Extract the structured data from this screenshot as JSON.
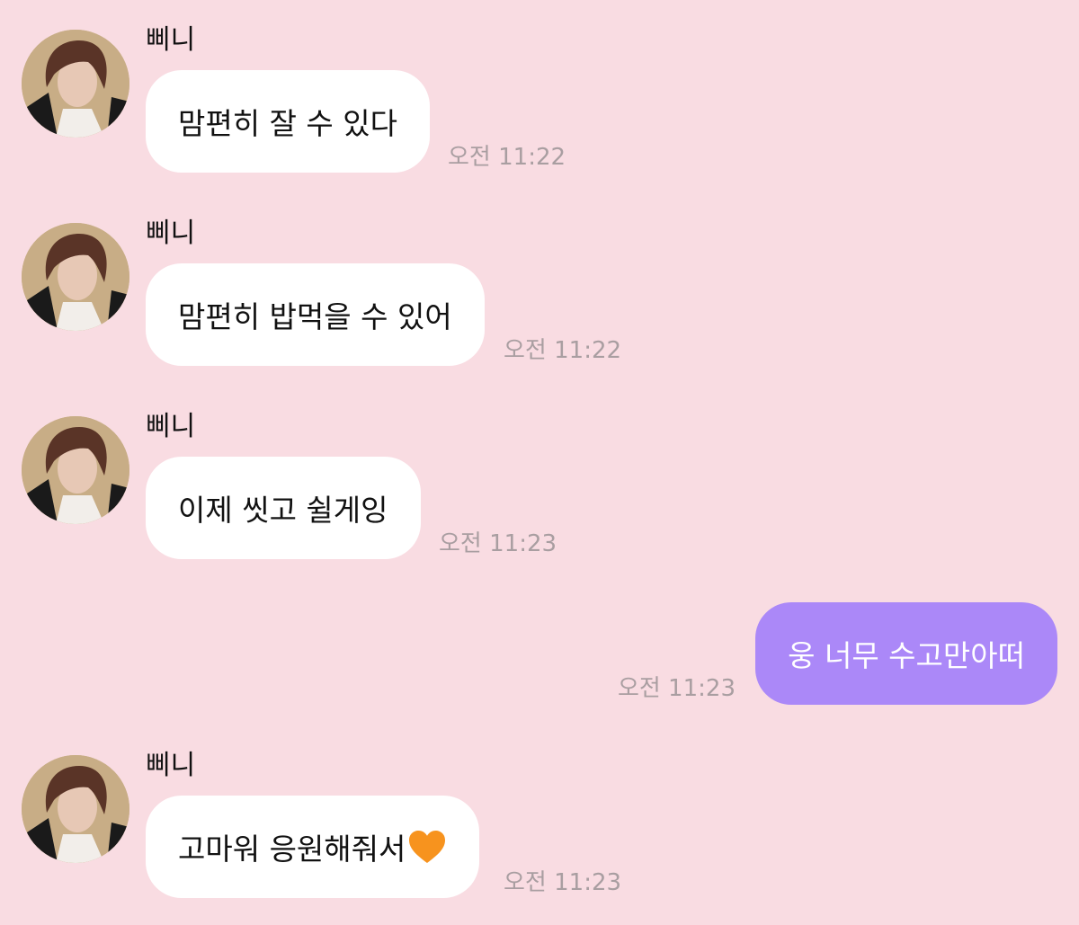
{
  "chat": {
    "messages": [
      {
        "sender": "삐니",
        "text": "맘편히 잘 수 있다",
        "time": "오전 11:22"
      },
      {
        "sender": "삐니",
        "text": "맘편히 밥먹을 수 있어",
        "time": "오전 11:22"
      },
      {
        "sender": "삐니",
        "text": "이제 씻고 쉴게잉",
        "time": "오전 11:23"
      },
      {
        "sender": "",
        "text": "웅 너무 수고만아떠",
        "time": "오전 11:23"
      },
      {
        "sender": "삐니",
        "text": "고마워 응원해줘서",
        "emoji": "orange-heart",
        "time": "오전 11:23"
      }
    ]
  },
  "colors": {
    "background": "#f9dce2",
    "incoming_bubble": "#ffffff",
    "outgoing_bubble": "#ab88f8",
    "timestamp": "#a99ea1",
    "heart": "#f7931e"
  }
}
